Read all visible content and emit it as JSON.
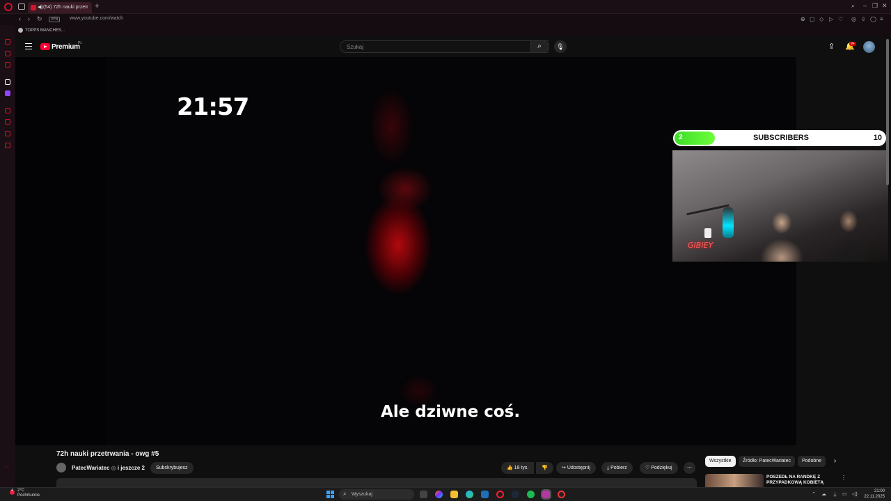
{
  "browser": {
    "tab_title": "(54) 72h nauki przetr",
    "new_tab": "+",
    "url": "www.youtube.com/watch",
    "vpn_label": "VPN",
    "bookmark": "TOPPS MANCHES..."
  },
  "youtube": {
    "logo_text": "Premium",
    "logo_region": "PL",
    "search_placeholder": "Szukaj",
    "notification_count": "9+"
  },
  "video": {
    "clock_overlay": "21:57",
    "subtitle": "Ale dziwne coś.",
    "sub_goal": {
      "current": "2",
      "label": "SUBSCRIBERS",
      "goal": "10",
      "progress_fraction": 0.2
    },
    "webcam_neon_text": "GIBIEY"
  },
  "info": {
    "title": "72h nauki przetrwania - owg #5",
    "channel": "PatecWariatec",
    "collab": "i jeszcze 2",
    "subscribe_label": "Subskrybujesz",
    "likes": "18 tys.",
    "share": "Udostępnij",
    "download": "Pobierz",
    "thanks": "Podziękuj",
    "more": "⋯"
  },
  "chips": [
    "Wszystkie",
    "Źródło: PatecWariatec",
    "Podobne"
  ],
  "recommendation": {
    "title": "POSZEDŁ NA RANDKĘ Z PRZYPADKOWĄ KOBIETĄ"
  },
  "taskbar": {
    "weather_temp": "2°C",
    "weather_desc": "Pochmurnie",
    "weather_badge": "4",
    "search_placeholder": "Wyszukaj",
    "time": "21:00",
    "date": "22.11.2025"
  },
  "colors": {
    "yt_red": "#ff0033",
    "opera_red": "#d3142b",
    "sub_green": "#3fdc2a",
    "background": "#0f0f0f"
  }
}
